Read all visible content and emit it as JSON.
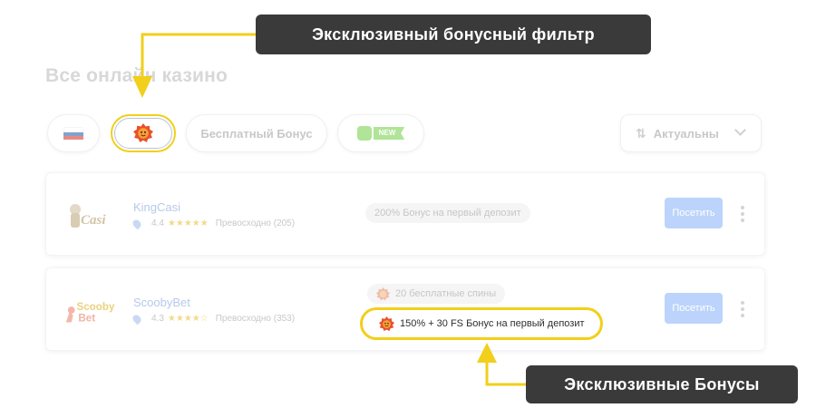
{
  "page": {
    "title": "Все онлайн казино"
  },
  "filters": {
    "free_bonus_label": "Бесплатный Бонус",
    "new_badge": "NEW",
    "sort_label": "Актуальны",
    "flag_colors": [
      "#ffffff",
      "#1c57a7",
      "#d52b1e"
    ]
  },
  "casinos": [
    {
      "name": "KingCasi",
      "logo_text": "Casi",
      "rating": "4.4",
      "stars": 4.4,
      "rating_text": "Превосходно (205)",
      "bonuses": [
        "200% Бонус на первый депозит"
      ],
      "visit_label": "Посетить"
    },
    {
      "name": "ScoobyBet",
      "logo_text_1": "Scooby",
      "logo_text_2": "Bet",
      "rating": "4.3",
      "stars": 4.3,
      "rating_text": "Превосходно (353)",
      "bonuses": [
        "20 бесплатные спины"
      ],
      "exclusive_bonus": "150% + 30 FS Бонус на первый депозит",
      "visit_label": "Посетить"
    }
  ],
  "annotations": {
    "filter_callout": "Эксклюзивный бонусный фильтр",
    "bonus_callout": "Эксклюзивные Бонусы",
    "highlight_color": "#f2cf1a",
    "callout_bg": "#3a3a3a"
  },
  "icons": {
    "exclusive": "orange-gear-badge-icon",
    "sort": "sort-arrows-icon",
    "location": "location-pin-icon",
    "menu": "kebab-menu-icon"
  }
}
